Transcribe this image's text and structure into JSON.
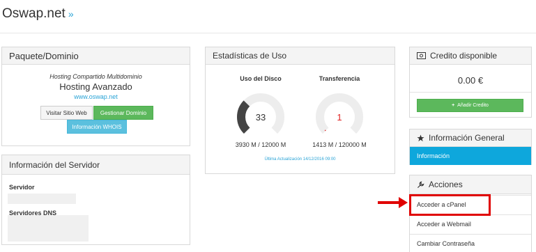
{
  "site": {
    "title": "Oswap.net",
    "chevron": "»"
  },
  "paquete": {
    "title": "Paquete/Dominio",
    "type": "Hosting Compartido Multidominio",
    "name": "Hosting Avanzado",
    "url": "www.oswap.net",
    "btn_visit": "Visitar Sitio Web",
    "btn_manage": "Gestionar Dominio",
    "btn_whois": "Información WHOIS"
  },
  "servidor": {
    "title": "Información del Servidor",
    "server_label": "Servidor",
    "dns_label": "Servidores DNS"
  },
  "stats": {
    "title": "Estadísticas de Uso",
    "disk": {
      "title": "Uso del Disco",
      "value": "33",
      "fraction": 0.33,
      "caption": "3930 M / 12000 M",
      "color": "#444444"
    },
    "transfer": {
      "title": "Transferencia",
      "value": "1",
      "fraction": 0.01,
      "caption": "1413 M / 120000 M",
      "color": "#e01f1f"
    },
    "updated": "Última Actualización 14/12/2016 09:00"
  },
  "credito": {
    "title": "Credito disponible",
    "amount": "0.00 €",
    "btn_add": "Añadir Credito"
  },
  "info": {
    "title": "Información General",
    "item": "Información"
  },
  "acciones": {
    "title": "Acciones",
    "items": [
      "Acceder a cPanel",
      "Acceder a Webmail",
      "Cambiar Contraseña"
    ]
  },
  "colors": {
    "accent": "#0ea7dc",
    "green": "#5cb85c",
    "highlight": "#e00000"
  }
}
